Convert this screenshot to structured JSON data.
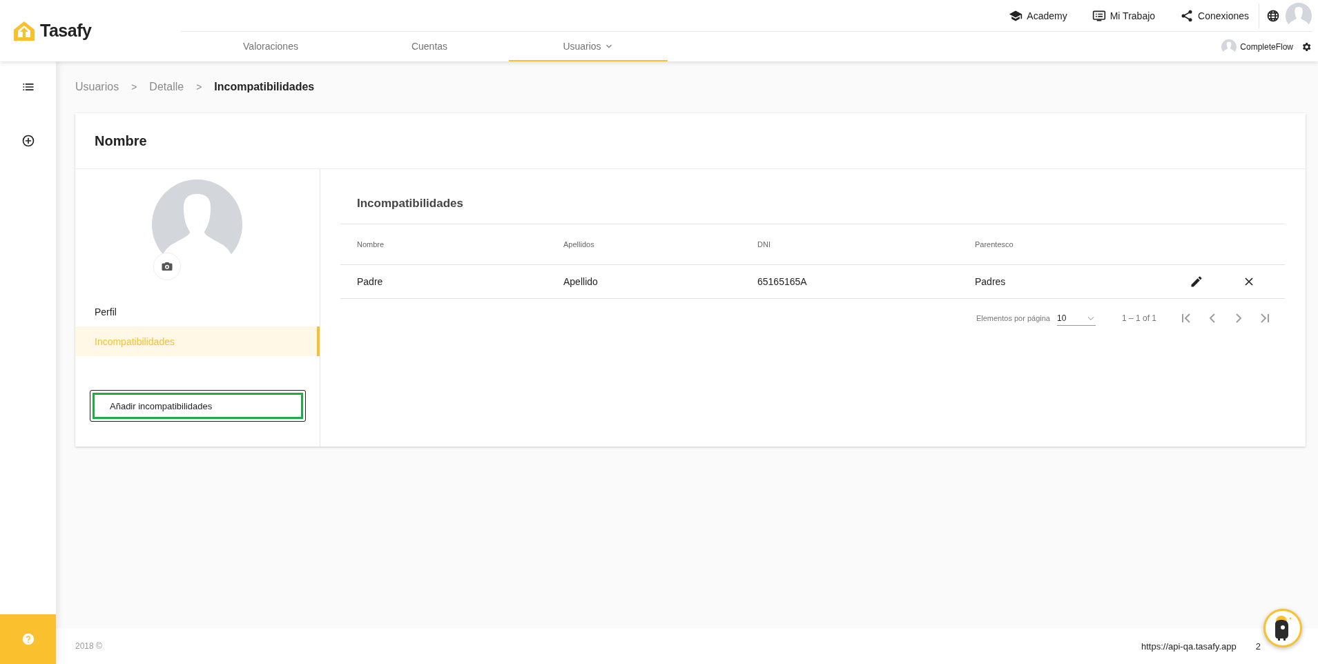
{
  "logo": {
    "text": "Tasafy"
  },
  "top_links": [
    {
      "label": "Academy",
      "kind": "academy"
    },
    {
      "label": "Mi Trabajo",
      "kind": "work"
    },
    {
      "label": "Conexiones",
      "kind": "share"
    }
  ],
  "nav_tabs": [
    {
      "label": "Valoraciones",
      "selected": false,
      "dropdown": false
    },
    {
      "label": "Cuentas",
      "selected": false,
      "dropdown": false
    },
    {
      "label": "Usuarios",
      "selected": true,
      "dropdown": true
    }
  ],
  "user": {
    "name": "CompleteFlow"
  },
  "breadcrumbs": [
    {
      "label": "Usuarios",
      "kind": "link"
    },
    {
      "label": ">",
      "kind": "separator"
    },
    {
      "label": "Detalle",
      "kind": "link"
    },
    {
      "label": ">",
      "kind": "separator"
    },
    {
      "label": "Incompatibilidades",
      "kind": "current"
    }
  ],
  "card": {
    "title": "Nombre"
  },
  "profile_menu": [
    {
      "label": "Perfil",
      "selected": false
    },
    {
      "label": "Incompatibilidades",
      "selected": true
    }
  ],
  "add_button": {
    "label": "Añadir incompatibilidades",
    "focused": true
  },
  "table": {
    "title": "Incompatibilidades",
    "columns": [
      "Nombre",
      "Apellidos",
      "DNI",
      "Parentesco"
    ],
    "rows": [
      {
        "cells": [
          "Padre",
          "Apellido",
          "65165165A",
          "Padres"
        ]
      }
    ]
  },
  "paginator": {
    "label": "Elementos por página",
    "page_size": "10",
    "range": "1 – 1 of 1",
    "buttons": [
      {
        "kind": "first"
      },
      {
        "kind": "prev"
      },
      {
        "kind": "next"
      },
      {
        "kind": "last"
      }
    ]
  },
  "footer": {
    "copyright": "2018 ©",
    "url": "https://api-qa.tasafy.app",
    "version": "2"
  }
}
